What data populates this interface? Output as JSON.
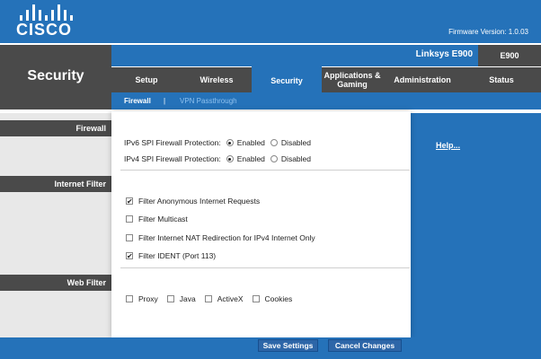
{
  "header": {
    "logo_text": "CISCO",
    "firmware": "Firmware Version: 1.0.03",
    "product_name": "Linksys E900",
    "model": "E900"
  },
  "section_title": "Security",
  "nav": {
    "tabs": [
      {
        "label": "Setup",
        "active": false
      },
      {
        "label": "Wireless",
        "active": false
      },
      {
        "label": "Security",
        "active": true
      },
      {
        "label": "Applications & Gaming",
        "active": false
      },
      {
        "label": "Administration",
        "active": false
      },
      {
        "label": "Status",
        "active": false
      }
    ],
    "subtabs": {
      "firewall": "Firewall",
      "separator": "|",
      "vpn": "VPN Passthrough"
    }
  },
  "sidebar": {
    "firewall": "Firewall",
    "internet_filter": "Internet Filter",
    "web_filter": "Web Filter"
  },
  "firewall": {
    "ipv6_label": "IPv6 SPI Firewall  Protection:",
    "ipv4_label": "IPv4 SPI Firewall  Protection:",
    "enabled": "Enabled",
    "disabled": "Disabled",
    "ipv6_value": "Enabled",
    "ipv4_value": "Enabled"
  },
  "internet_filter": {
    "anonymous": {
      "label": "Filter Anonymous Internet Requests",
      "checked": true
    },
    "multicast": {
      "label": "Filter Multicast",
      "checked": false
    },
    "nat": {
      "label": "Filter Internet NAT Redirection for IPv4 Internet Only",
      "checked": false
    },
    "ident": {
      "label": "Filter IDENT (Port 113)",
      "checked": true
    }
  },
  "web_filter": {
    "proxy": {
      "label": "Proxy",
      "checked": false
    },
    "java": {
      "label": "Java",
      "checked": false
    },
    "activex": {
      "label": "ActiveX",
      "checked": false
    },
    "cookies": {
      "label": "Cookies",
      "checked": false
    }
  },
  "help": "Help...",
  "buttons": {
    "save": "Save Settings",
    "cancel": "Cancel Changes"
  },
  "colors": {
    "brand_blue": "#2572b9",
    "dark_gray": "#4a4a4a",
    "side_gray": "#e8e8e8"
  }
}
